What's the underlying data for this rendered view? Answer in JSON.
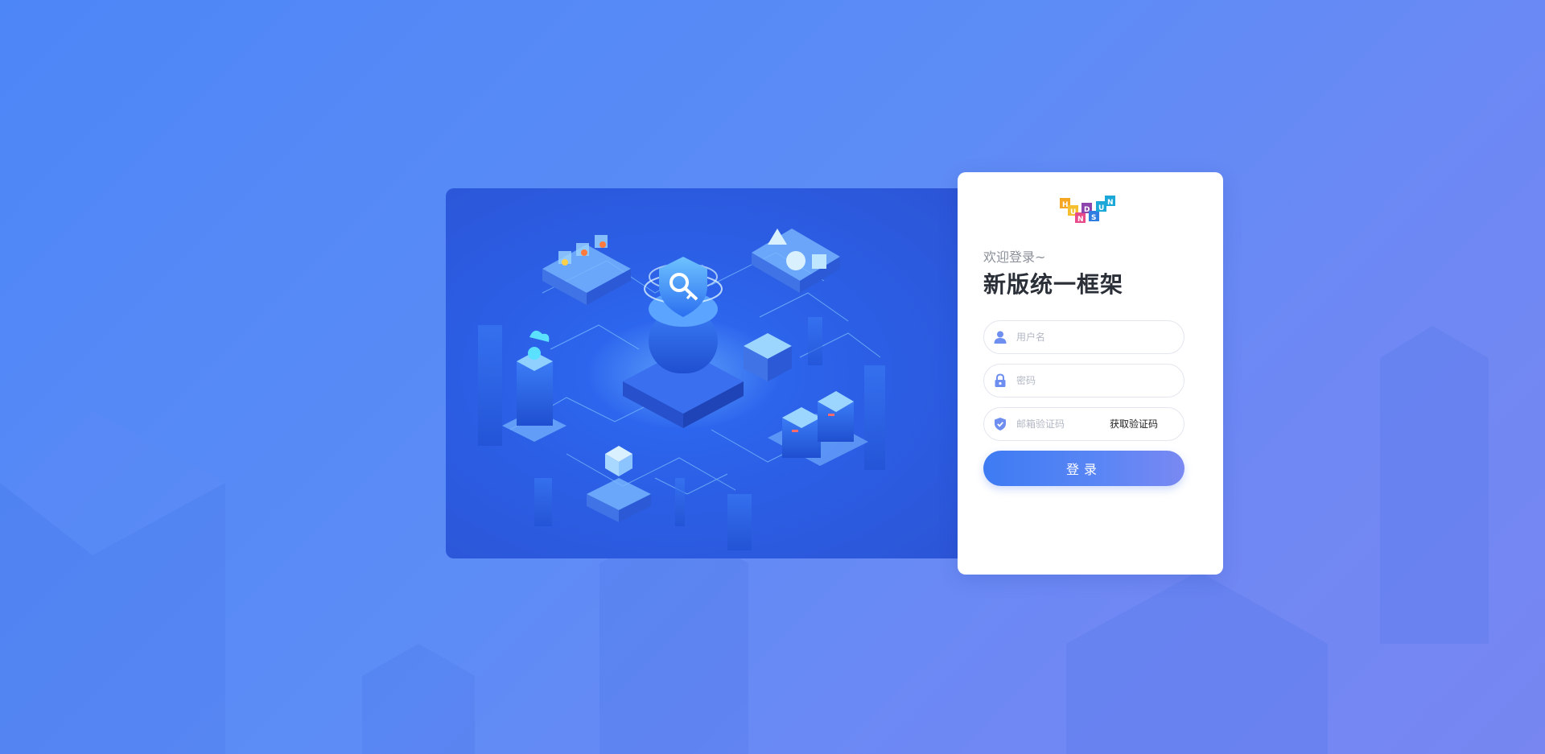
{
  "brand": {
    "logo_name": "HUNDSUN",
    "logo_letters": [
      "H",
      "U",
      "N",
      "D",
      "S",
      "U",
      "N"
    ],
    "logo_colors": [
      "#f5a623",
      "#e94b8a",
      "#8e44ad",
      "#2f7de1",
      "#1ba7d8",
      "#2f7de1",
      "#1ba7d8"
    ]
  },
  "login": {
    "welcome": "欢迎登录~",
    "title": "新版统一框架",
    "username_placeholder": "用户名",
    "password_placeholder": "密码",
    "code_placeholder": "邮箱验证码",
    "get_code_label": "获取验证码",
    "submit_label": "登录"
  },
  "icons": {
    "username": "user-icon",
    "password": "lock-icon",
    "code": "shield-icon"
  },
  "colors": {
    "accent": "#3e7bf3",
    "icon": "#6f8ff0",
    "background_start": "#4d86f7",
    "background_end": "#7786f1"
  }
}
